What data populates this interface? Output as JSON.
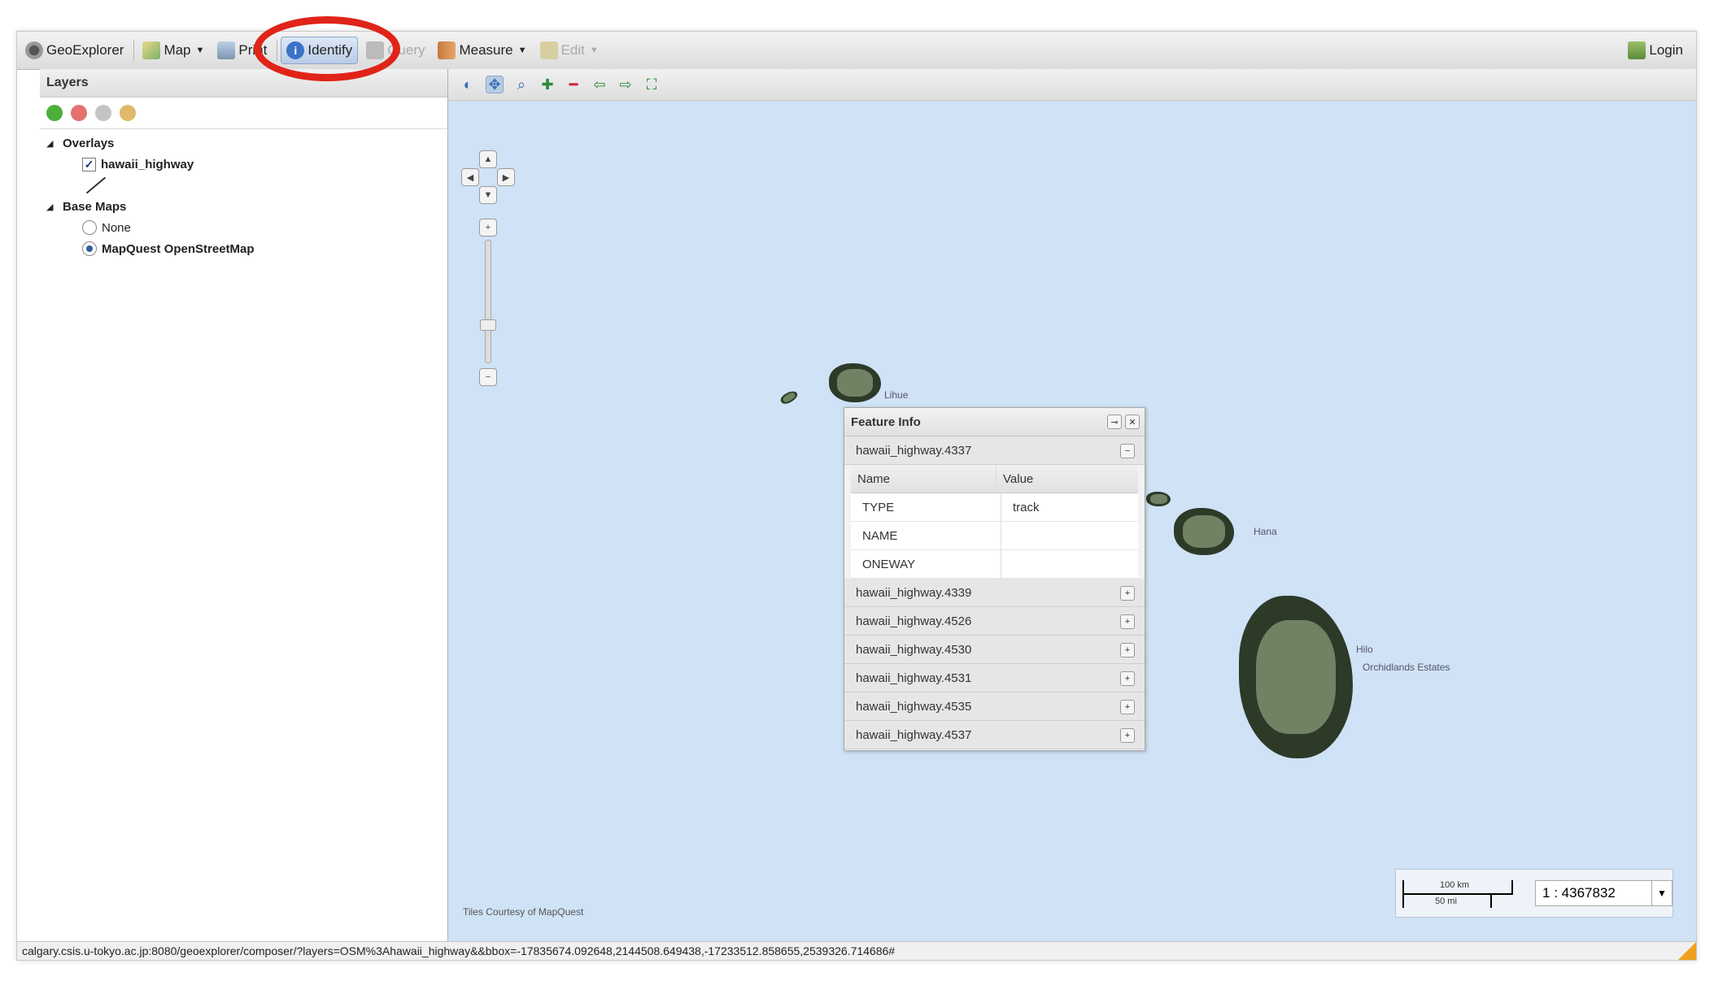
{
  "toolbar": {
    "geoexplorer": "GeoExplorer",
    "map": "Map",
    "print": "Print",
    "identify": "Identify",
    "query": "Query",
    "measure": "Measure",
    "edit": "Edit",
    "login": "Login"
  },
  "layers_panel": {
    "title": "Layers",
    "overlays_label": "Overlays",
    "overlay_layer": "hawaii_highway",
    "basemaps_label": "Base Maps",
    "basemap_none": "None",
    "basemap_selected": "MapQuest OpenStreetMap"
  },
  "map": {
    "places": [
      "Lihue",
      "Hana",
      "Hilo",
      "Orchidlands Estates"
    ],
    "attribution": "Tiles Courtesy of MapQuest",
    "scale_km": "100 km",
    "scale_mi": "50 mi",
    "scale_value": "1 : 4367832"
  },
  "feature_info": {
    "title": "Feature Info",
    "expanded_group": "hawaii_highway.4337",
    "columns": [
      "Name",
      "Value"
    ],
    "rows": [
      {
        "name": "TYPE",
        "value": "track"
      },
      {
        "name": "NAME",
        "value": ""
      },
      {
        "name": "ONEWAY",
        "value": ""
      }
    ],
    "collapsed_groups": [
      "hawaii_highway.4339",
      "hawaii_highway.4526",
      "hawaii_highway.4530",
      "hawaii_highway.4531",
      "hawaii_highway.4535",
      "hawaii_highway.4537"
    ]
  },
  "statusbar": {
    "url": "calgary.csis.u-tokyo.ac.jp:8080/geoexplorer/composer/?layers=OSM%3Ahawaii_highway&&bbox=-17835674.092648,2144508.649438,-17233512.858655,2539326.714686#"
  },
  "colors": {
    "sea": "#cfe2f6",
    "highlight_ring": "#e02418",
    "active_tool": "#b9cce6"
  }
}
